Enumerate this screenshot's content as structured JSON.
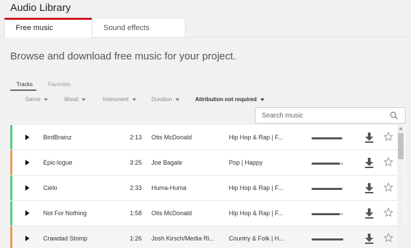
{
  "header": {
    "title": "Audio Library"
  },
  "tabs": {
    "free_music": "Free music",
    "sound_effects": "Sound effects"
  },
  "subtitle": "Browse and download free music for your project.",
  "subtabs": {
    "tracks": "Tracks",
    "favorites": "Favorites"
  },
  "filters": {
    "genre": "Genre",
    "mood": "Mood",
    "instrument": "Instrument",
    "duration": "Duration",
    "attribution": "Attribution not required"
  },
  "search": {
    "placeholder": "Search music",
    "value": ""
  },
  "colors": {
    "accent": "#cc181e",
    "green": "#4ccf7a",
    "orange": "#f0954b"
  },
  "tracks": [
    {
      "title": "BirdBrainz",
      "duration": "2:13",
      "artist": "Otis McDonald",
      "genre": "Hip Hop & Rap | F...",
      "popularity": 0.95,
      "color": "#4ccf7a"
    },
    {
      "title": "Epic-logue",
      "duration": "3:25",
      "artist": "Joe Bagale",
      "genre": "Pop | Happy",
      "popularity": 0.9,
      "color": "#f0954b"
    },
    {
      "title": "Cielo",
      "duration": "2:33",
      "artist": "Huma-Huma",
      "genre": "Hip Hop & Rap | F...",
      "popularity": 0.95,
      "color": "#4ccf7a"
    },
    {
      "title": "Not For Nothing",
      "duration": "1:58",
      "artist": "Otis McDonald",
      "genre": "Hip Hop & Rap | F...",
      "popularity": 0.9,
      "color": "#4ccf7a"
    },
    {
      "title": "Crawdad Stomp",
      "duration": "1:26",
      "artist": "Josh Kirsch/Media Ri...",
      "genre": "Country & Folk | H...",
      "popularity": 1.0,
      "color": "#f0954b"
    }
  ]
}
